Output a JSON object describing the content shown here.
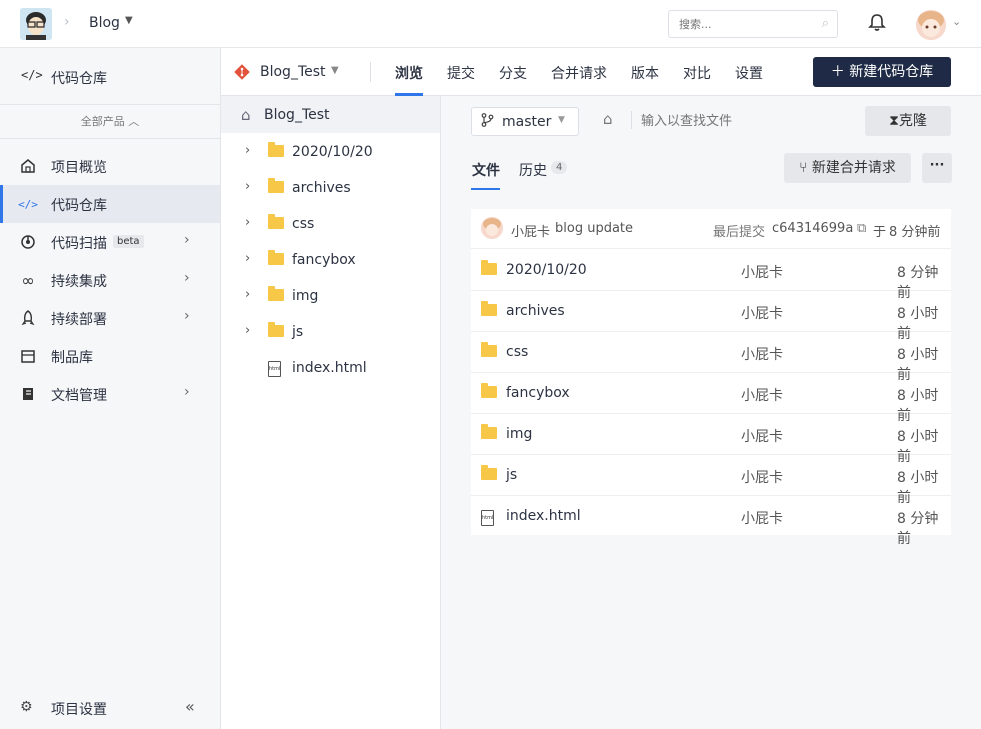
{
  "topbar": {
    "project_name": "Blog",
    "search_placeholder": "搜索...",
    "separator": "›"
  },
  "sidebar": {
    "top_item": {
      "label": "代码仓库",
      "icon": "code-icon"
    },
    "all_products": "全部产品",
    "items": [
      {
        "label": "项目概览",
        "icon": "home-icon",
        "active": false,
        "chevron": false
      },
      {
        "label": "代码仓库",
        "icon": "code-icon",
        "active": true,
        "chevron": false
      },
      {
        "label": "代码扫描",
        "icon": "scan-icon",
        "active": false,
        "chevron": true,
        "badge": "beta"
      },
      {
        "label": "持续集成",
        "icon": "infinity-icon",
        "active": false,
        "chevron": true
      },
      {
        "label": "持续部署",
        "icon": "rocket-icon",
        "active": false,
        "chevron": true
      },
      {
        "label": "制品库",
        "icon": "package-icon",
        "active": false,
        "chevron": false
      },
      {
        "label": "文档管理",
        "icon": "document-icon",
        "active": false,
        "chevron": true
      }
    ],
    "settings_label": "项目设置"
  },
  "repo_header": {
    "repo_name": "Blog_Test",
    "tabs": [
      "浏览",
      "提交",
      "分支",
      "合并请求",
      "版本",
      "对比",
      "设置"
    ],
    "active_tab": "浏览",
    "new_repo_button": "新建代码仓库"
  },
  "file_tree": {
    "root": "Blog_Test",
    "items": [
      {
        "name": "2020/10/20",
        "type": "folder"
      },
      {
        "name": "archives",
        "type": "folder"
      },
      {
        "name": "css",
        "type": "folder"
      },
      {
        "name": "fancybox",
        "type": "folder"
      },
      {
        "name": "img",
        "type": "folder"
      },
      {
        "name": "js",
        "type": "folder"
      },
      {
        "name": "index.html",
        "type": "html"
      }
    ]
  },
  "main": {
    "branch": "master",
    "path_placeholder": "输入以查找文件",
    "clone_button": "克隆",
    "subtabs": {
      "files": "文件",
      "history": "历史",
      "history_count": "4"
    },
    "merge_request_button": "新建合并请求",
    "more_button": "···",
    "commit": {
      "author": "小屁卡",
      "message": "blog update",
      "last_commit_label": "最后提交",
      "hash": "c64314699a",
      "time_prefix": "于",
      "time": "8 分钟前"
    },
    "files": [
      {
        "name": "2020/10/20",
        "type": "folder",
        "author": "小屁卡",
        "time": "8 分钟前"
      },
      {
        "name": "archives",
        "type": "folder",
        "author": "小屁卡",
        "time": "8 小时前"
      },
      {
        "name": "css",
        "type": "folder",
        "author": "小屁卡",
        "time": "8 小时前"
      },
      {
        "name": "fancybox",
        "type": "folder",
        "author": "小屁卡",
        "time": "8 小时前"
      },
      {
        "name": "img",
        "type": "folder",
        "author": "小屁卡",
        "time": "8 小时前"
      },
      {
        "name": "js",
        "type": "folder",
        "author": "小屁卡",
        "time": "8 小时前"
      },
      {
        "name": "index.html",
        "type": "html",
        "author": "小屁卡",
        "time": "8 分钟前"
      }
    ]
  },
  "colors": {
    "accent": "#2f76e9",
    "primary_button": "#1f2b46",
    "folder": "#f7c748",
    "git": "#e2513a"
  }
}
